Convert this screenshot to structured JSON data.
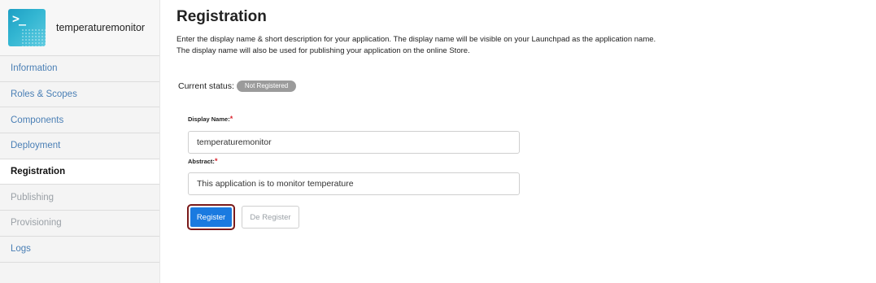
{
  "app": {
    "name": "temperaturemonitor",
    "icon": "terminal-prompt-icon",
    "icon_prompt": ">_"
  },
  "sidebar": {
    "items": [
      {
        "label": "Information",
        "state": "link"
      },
      {
        "label": "Roles & Scopes",
        "state": "link"
      },
      {
        "label": "Components",
        "state": "link"
      },
      {
        "label": "Deployment",
        "state": "link"
      },
      {
        "label": "Registration",
        "state": "active"
      },
      {
        "label": "Publishing",
        "state": "disabled"
      },
      {
        "label": "Provisioning",
        "state": "disabled"
      },
      {
        "label": "Logs",
        "state": "link"
      }
    ]
  },
  "main": {
    "title": "Registration",
    "description_line1": "Enter the display name & short description for your application. The display name will be visible on your Launchpad as the application name.",
    "description_line2": "The display name will also be used for publishing your application on the online Store.",
    "status_label": "Current status:",
    "status_value": "Not Registered",
    "display_name_label": "Display Name:",
    "display_name_value": "temperaturemonitor",
    "abstract_label": "Abstract:",
    "abstract_value": "This application is to monitor temperature",
    "required_marker": "*",
    "register_label": "Register",
    "deregister_label": "De Register"
  },
  "colors": {
    "accent": "#1a7ae0",
    "link": "#4a7fb5",
    "required": "#d9232d",
    "badge": "#9b9b9b",
    "focus_outline": "#7a1a1a"
  }
}
